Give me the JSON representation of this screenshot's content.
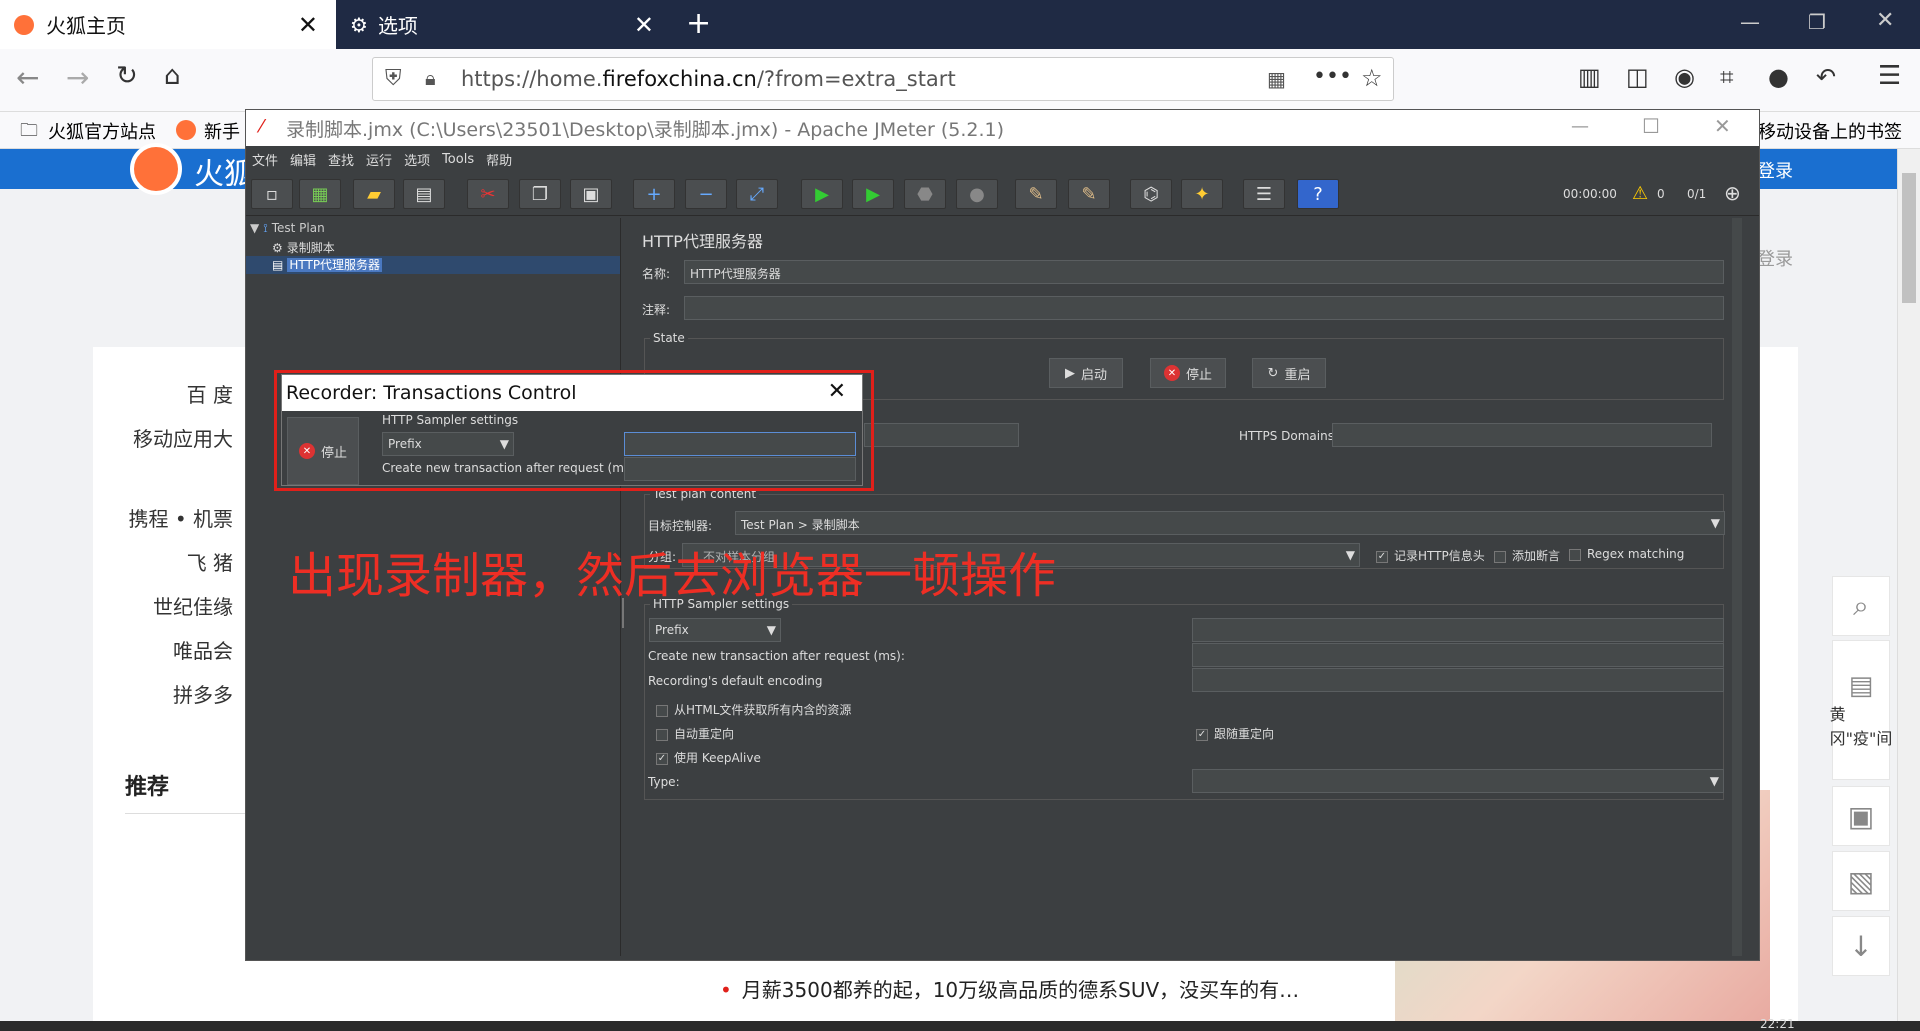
{
  "browser": {
    "tabs": [
      {
        "label": "火狐主页"
      },
      {
        "label": "选项"
      }
    ],
    "url": {
      "prefix": "https://home.",
      "domain": "firefoxchina.cn",
      "path": "/?from=extra_start"
    },
    "bookmarks": [
      {
        "label": "火狐官方站点"
      },
      {
        "label": "新手"
      },
      {
        "label": "移动设备上的书签"
      }
    ]
  },
  "page": {
    "logo_text": "火狐",
    "login_text": "登录",
    "nav": [
      "百 度",
      "移动应用大",
      "携程 • 机票",
      "飞 猪",
      "世纪佳缘",
      "唯品会",
      "拼多多"
    ],
    "recommend": "推荐",
    "news": "月薪3500都养的起，10万级高品质的德系SUV，没买车的有…",
    "side_news": "黄冈\"疫\"间",
    "bottom_time": "22:21"
  },
  "jmeter": {
    "title": "录制脚本.jmx (C:\\Users\\23501\\Desktop\\录制脚本.jmx) - Apache JMeter (5.2.1)",
    "menu": [
      "文件",
      "编辑",
      "查找",
      "运行",
      "选项",
      "Tools",
      "帮助"
    ],
    "toolbar_status": {
      "time": "00:00:00",
      "warnings": "0",
      "threads": "0/1"
    },
    "tree": {
      "root": "Test Plan",
      "child": "录制脚本",
      "selected": "HTTP代理服务器"
    },
    "panel": {
      "heading": "HTTP代理服务器",
      "name_label": "名称:",
      "name_value": "HTTP代理服务器",
      "comment_label": "注释:",
      "state_label": "State",
      "start": "启动",
      "stop": "停止",
      "restart": "重启",
      "https_domains": "HTTPS Domains:",
      "test_plan_content": "Test plan content",
      "target_label": "目标控制器:",
      "target_value": "Test Plan > 录制脚本",
      "group_label": "分组:",
      "group_value": "不对样本分组",
      "record_headers": "记录HTTP信息头",
      "add_assert": "添加断言",
      "regex_matching": "Regex matching",
      "sampler_settings": "HTTP Sampler settings",
      "prefix": "Prefix",
      "create_after": "Create new transaction after request (ms):",
      "default_encoding": "Recording's default encoding",
      "retrieve_all": "从HTML文件获取所有内含的资源",
      "auto_redirect": "自动重定向",
      "follow_redirect": "跟随重定向",
      "keepalive": "使用 KeepAlive",
      "type_label": "Type:"
    }
  },
  "recorder": {
    "title": "Recorder: Transactions Control",
    "stop": "停止",
    "settings": "HTTP Sampler settings",
    "prefix": "Prefix",
    "create_after": "Create new transaction after request (ms):"
  },
  "annotation": "出现录制器，然后去浏览器一顿操作"
}
